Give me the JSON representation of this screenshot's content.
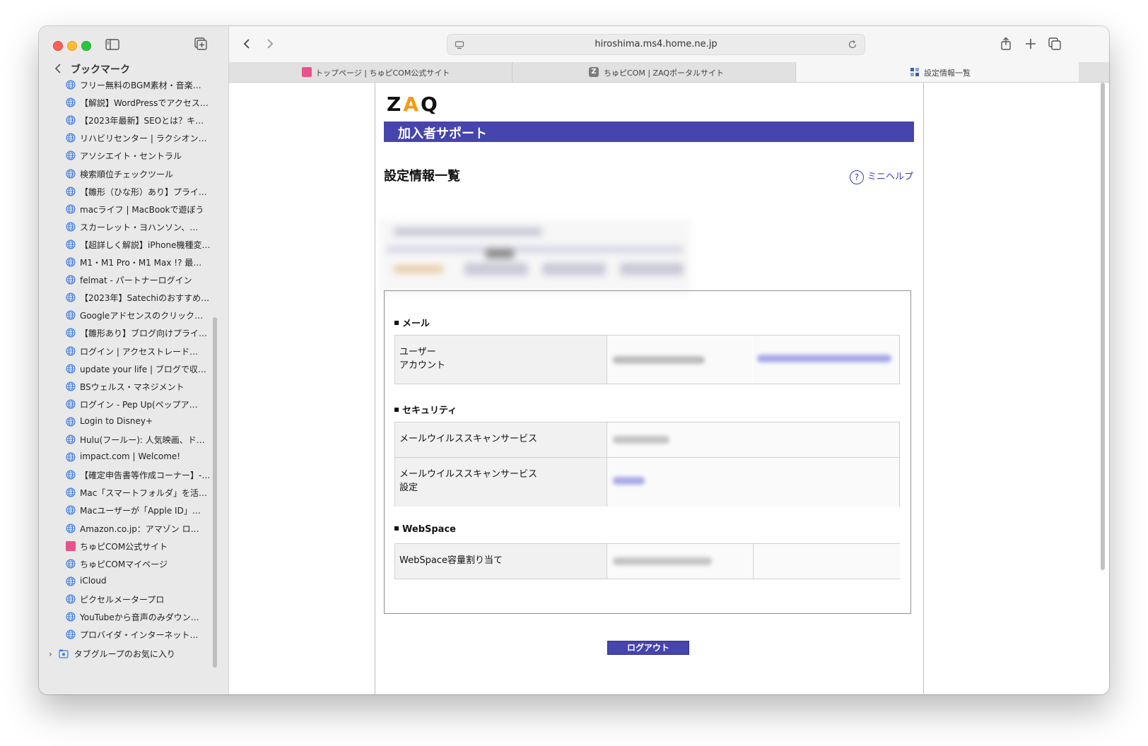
{
  "browser": {
    "url": "hiroshima.ms4.home.ne.jp",
    "tabs": [
      {
        "label": "トップページ | ちゅピCOM公式サイト",
        "favicon": "chupicom-pink-icon"
      },
      {
        "label": "ちゅピCOM | ZAQポータルサイト",
        "favicon": "zaq-z-icon"
      },
      {
        "label": "設定情報一覧",
        "favicon": "page-grid-icon",
        "active": true
      }
    ]
  },
  "sidebar": {
    "title": "ブックマーク",
    "items": [
      "フリー無料のBGM素材・音楽…",
      "【解説】WordPressでアクセス…",
      "【2023年最新】SEOとは？キ…",
      "リハビリセンター | ラクシオン…",
      "アソシエイト・セントラル",
      "検索順位チェックツール",
      "【雛形（ひな形）あり】プライバ…",
      "macライフ | MacBookで遊ぼう",
      "スカーレット・ヨハンソン、…",
      "【超詳しく解説】iPhone機種変…",
      "M1・M1 Pro・M1 Max !? 最…",
      "felmat - パートナーログイン",
      "【2023年】Satechiのおすすめ…",
      "Googleアドセンスのクリック…",
      "【雛形あり】ブログ向けプライ…",
      "ログイン | アクセストレード…",
      "update your life | ブログで収…",
      "BSウェルス・マネジメント",
      "ログイン - Pep Up(ペップア…",
      "Login to Disney+",
      "Hulu(フールー): 人気映画、ド…",
      "impact.com | Welcome!",
      "【確定申告書等作成コーナー】-…",
      "Mac「スマートフォルダ」を活…",
      "Macユーザーが「Apple ID」…",
      "Amazon.co.jp：アマゾン ロ…",
      "ちゅピCOM公式サイト",
      "ちゅピCOMマイページ",
      "iCloud",
      "ピクセルメータープロ",
      "YouTubeから音声のみダウン…",
      "プロバイダ・インターネット…"
    ],
    "folder": "タブグループのお気に入り"
  },
  "page": {
    "logo": {
      "z": "Z",
      "a": "A",
      "q": "Q"
    },
    "banner": "加入者サポート",
    "title": "設定情報一覧",
    "minihelp": "ミニヘルプ",
    "minihelp_q": "?",
    "sections": [
      {
        "title": "メール",
        "rows": [
          {
            "label_lines": [
              "ユーザー",
              "アカウント"
            ]
          }
        ]
      },
      {
        "title": "セキュリティ",
        "rows": [
          {
            "label_lines": [
              "メールウイルススキャンサービス"
            ]
          },
          {
            "label_lines": [
              "メールウイルススキャンサービス",
              "設定"
            ]
          }
        ]
      },
      {
        "title": "WebSpace",
        "rows": [
          {
            "label_lines": [
              "WebSpace容量割り当て"
            ]
          }
        ]
      }
    ],
    "logout": "ログアウト"
  },
  "colors": {
    "banner": "#4645ad",
    "link": "#3c3cbe",
    "zaq_a": "#f39c12"
  }
}
